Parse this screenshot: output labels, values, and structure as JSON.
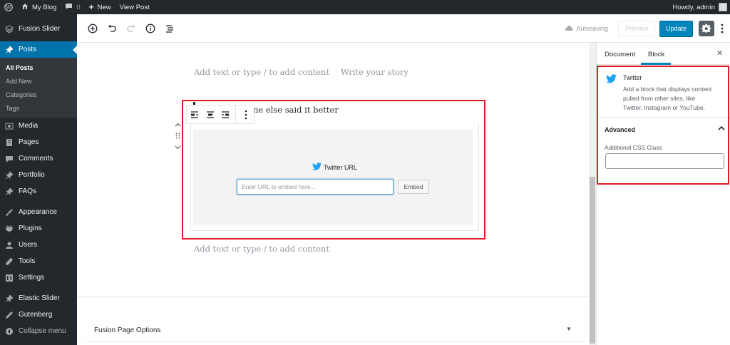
{
  "adminbar": {
    "site_name": "My Blog",
    "comments_count": "0",
    "new_label": "New",
    "view_post_label": "View Post",
    "howdy": "Howdy, admin"
  },
  "sidebar": {
    "items": [
      {
        "label": "Fusion Slider",
        "icon": "fusion-icon"
      },
      {
        "label": "Posts",
        "icon": "pin-icon"
      },
      {
        "label": "Media",
        "icon": "media-icon"
      },
      {
        "label": "Pages",
        "icon": "pages-icon"
      },
      {
        "label": "Comments",
        "icon": "comments-icon"
      },
      {
        "label": "Portfolio",
        "icon": "pin-icon"
      },
      {
        "label": "FAQs",
        "icon": "pin-icon"
      },
      {
        "label": "Appearance",
        "icon": "brush-icon"
      },
      {
        "label": "Plugins",
        "icon": "plug-icon"
      },
      {
        "label": "Users",
        "icon": "user-icon"
      },
      {
        "label": "Tools",
        "icon": "wrench-icon"
      },
      {
        "label": "Settings",
        "icon": "settings-icon"
      },
      {
        "label": "Elastic Slider",
        "icon": "pin-icon"
      },
      {
        "label": "Gutenberg",
        "icon": "pen-icon"
      },
      {
        "label": "Collapse menu",
        "icon": "collapse-icon"
      }
    ],
    "posts_submenu": [
      "All Posts",
      "Add New",
      "Categories",
      "Tags"
    ]
  },
  "editor_header": {
    "autosaving": "Autosaving",
    "preview": "Preview",
    "update": "Update"
  },
  "content": {
    "placeholder_top": "Add text or type / to add content",
    "write_story": "Write your story",
    "embed_caption": "ne else said it better",
    "embed_label": "Twitter URL",
    "url_placeholder": "Enter URL to embed here...",
    "embed_button": "Embed",
    "placeholder_bottom": "Add text or type / to add content",
    "fusion_options": "Fusion Page Options"
  },
  "settings": {
    "tab_document": "Document",
    "tab_block": "Block",
    "block_name": "Twitter",
    "block_description": "Add a block that displays content pulled from other sites, like Twitter, Instagram or YouTube.",
    "advanced": "Advanced",
    "css_class_label": "Additional CSS Class"
  },
  "colors": {
    "admin_dark": "#23282d",
    "accent_blue": "#0073aa",
    "update_blue": "#0085ba",
    "highlight_red": "#e01b24",
    "twitter_blue": "#1da1f2"
  }
}
